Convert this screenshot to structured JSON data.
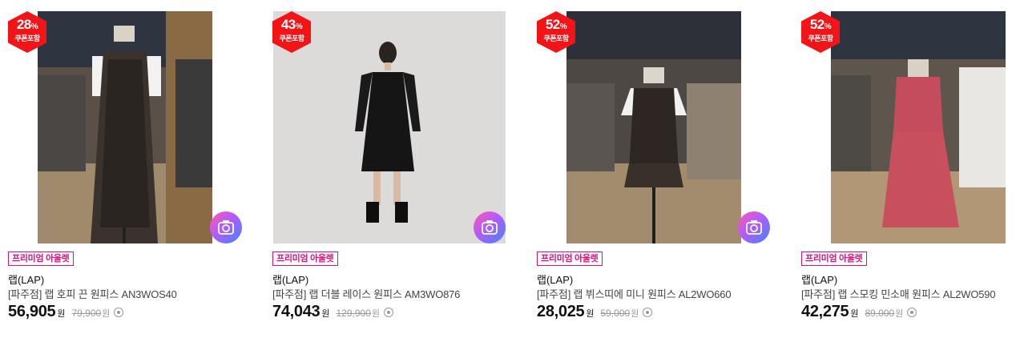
{
  "products": [
    {
      "discount": "28",
      "discount_unit": "%",
      "coupon_label": "쿠폰포함",
      "tag": "프리미엄 아울렛",
      "brand": "랩(LAP)",
      "name": "[파주점] 랩 호피 끈 원피스 AN3WOS40",
      "price": "56,905",
      "currency": "원",
      "original_price": "79,900",
      "original_currency": "원",
      "has_camera_button": true
    },
    {
      "discount": "43",
      "discount_unit": "%",
      "coupon_label": "쿠폰포함",
      "tag": "프리미엄 아울렛",
      "brand": "랩(LAP)",
      "name": "[파주점] 랩 더블 레이스 원피스 AM3WO876",
      "price": "74,043",
      "currency": "원",
      "original_price": "129,900",
      "original_currency": "원",
      "has_camera_button": true
    },
    {
      "discount": "52",
      "discount_unit": "%",
      "coupon_label": "쿠폰포함",
      "tag": "프리미엄 아울렛",
      "brand": "랩(LAP)",
      "name": "[파주점] 랩 뷔스띠에 미니 원피스 AL2WO660",
      "price": "28,025",
      "currency": "원",
      "original_price": "59,000",
      "original_currency": "원",
      "has_camera_button": true
    },
    {
      "discount": "52",
      "discount_unit": "%",
      "coupon_label": "쿠폰포함",
      "tag": "프리미엄 아울렛",
      "brand": "랩(LAP)",
      "name": "[파주점] 랩 스모킹 민소매 원피스 AL2WO590",
      "price": "42,275",
      "currency": "원",
      "original_price": "89,000",
      "original_currency": "원",
      "has_camera_button": false
    }
  ],
  "icons": {
    "camera": "camera-search-icon",
    "info": "info-circle-icon"
  },
  "colors": {
    "badge": "#f21416",
    "tag": "#d1157f",
    "strike": "#999999"
  }
}
